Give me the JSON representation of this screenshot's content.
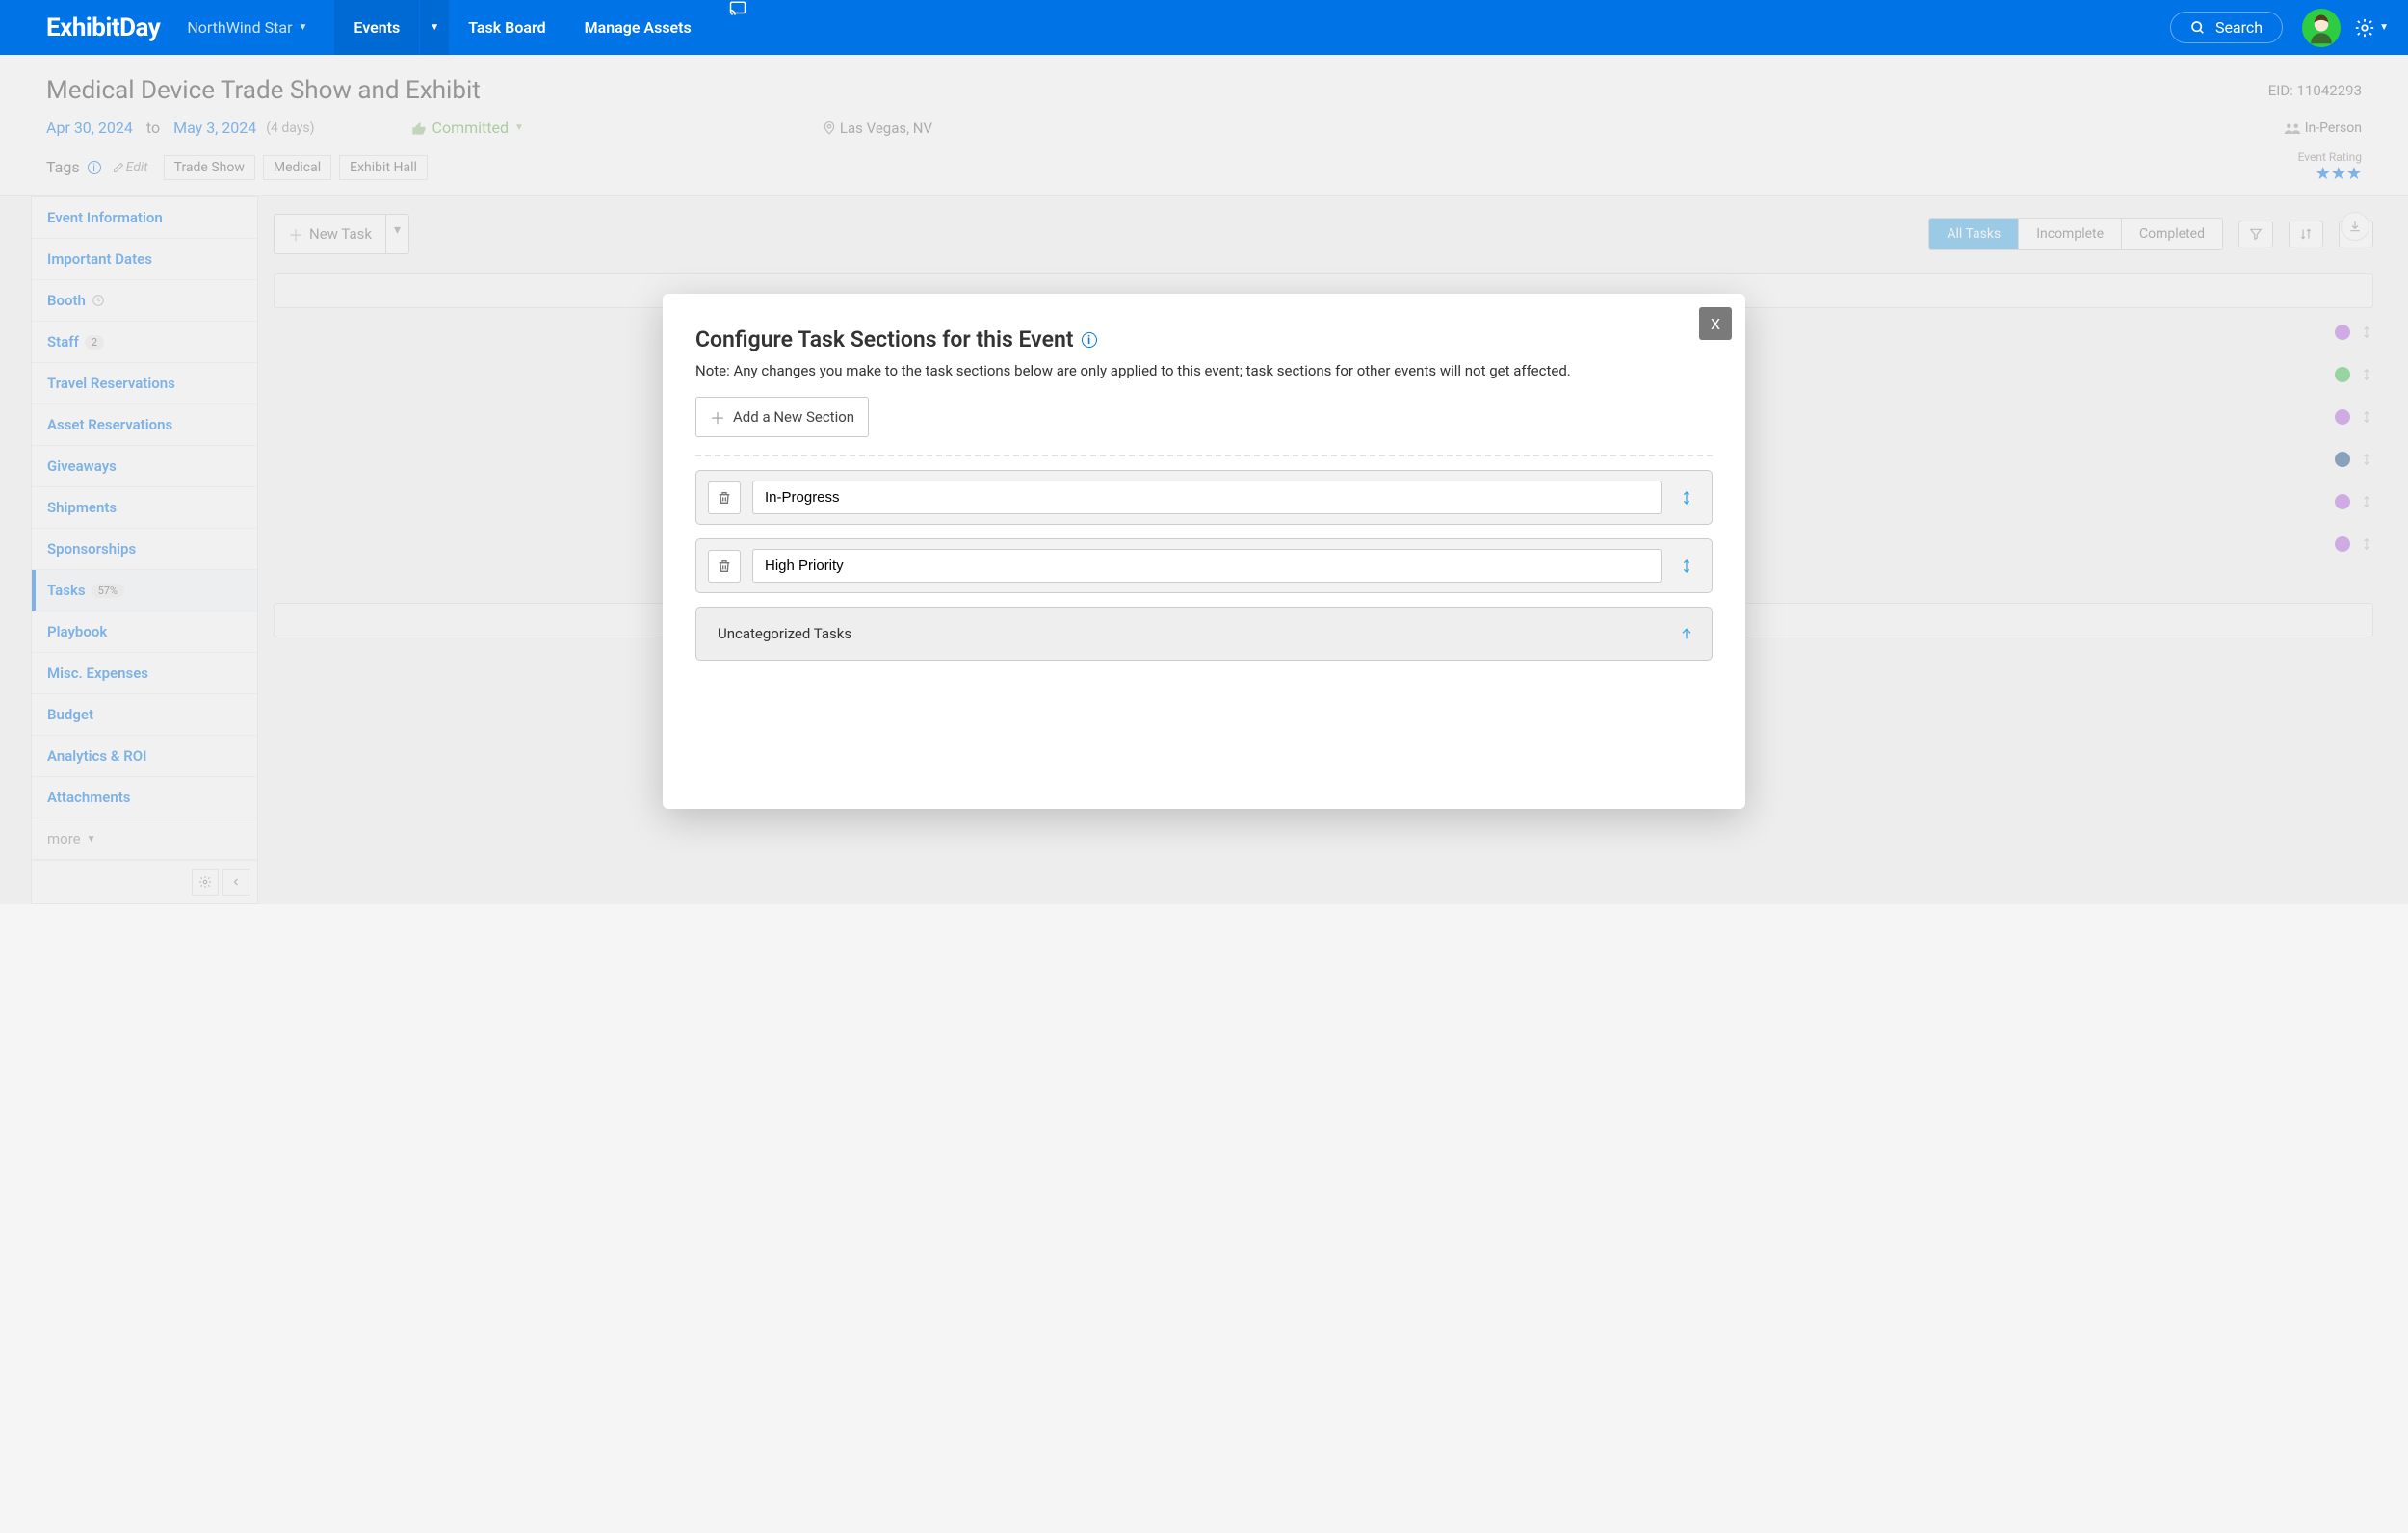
{
  "brand": "ExhibitDay",
  "workspace": "NorthWind Star",
  "nav": {
    "events": "Events",
    "taskboard": "Task Board",
    "assets": "Manage Assets",
    "search": "Search"
  },
  "event": {
    "title": "Medical Device Trade Show and Exhibit",
    "eid": "EID: 11042293",
    "start": "Apr 30, 2024",
    "to": "to",
    "end": "May 3, 2024",
    "days": "(4 days)",
    "status": "Committed",
    "location": "Las Vegas, NV",
    "format": "In-Person",
    "rating_label": "Event Rating",
    "tags_label": "Tags",
    "edit": "Edit",
    "tags": [
      "Trade Show",
      "Medical",
      "Exhibit Hall"
    ]
  },
  "sidebar": {
    "items": [
      {
        "label": "Event Information"
      },
      {
        "label": "Important Dates"
      },
      {
        "label": "Booth",
        "icon": "clock"
      },
      {
        "label": "Staff",
        "pill": "2"
      },
      {
        "label": "Travel Reservations"
      },
      {
        "label": "Asset Reservations"
      },
      {
        "label": "Giveaways"
      },
      {
        "label": "Shipments"
      },
      {
        "label": "Sponsorships"
      },
      {
        "label": "Tasks",
        "pill": "57%",
        "active": true
      },
      {
        "label": "Playbook"
      },
      {
        "label": "Misc. Expenses"
      },
      {
        "label": "Budget"
      },
      {
        "label": "Analytics & ROI"
      },
      {
        "label": "Attachments"
      }
    ],
    "more": "more"
  },
  "tasks": {
    "new": "New Task",
    "filters": {
      "all": "All Tasks",
      "incomplete": "Incomplete",
      "completed": "Completed"
    },
    "row_dots": [
      "#b266e0",
      "#39c24d",
      "#b266e0",
      "#1a4e8a",
      "#b266e0",
      "#b266e0"
    ]
  },
  "modal": {
    "title": "Configure Task Sections for this Event",
    "note": "Note: Any changes you make to the task sections below are only applied to this event; task sections for other events will not get affected.",
    "add": "Add a New Section",
    "close": "X",
    "sections": [
      {
        "value": "In-Progress"
      },
      {
        "value": "High Priority"
      }
    ],
    "uncategorized": "Uncategorized Tasks"
  }
}
